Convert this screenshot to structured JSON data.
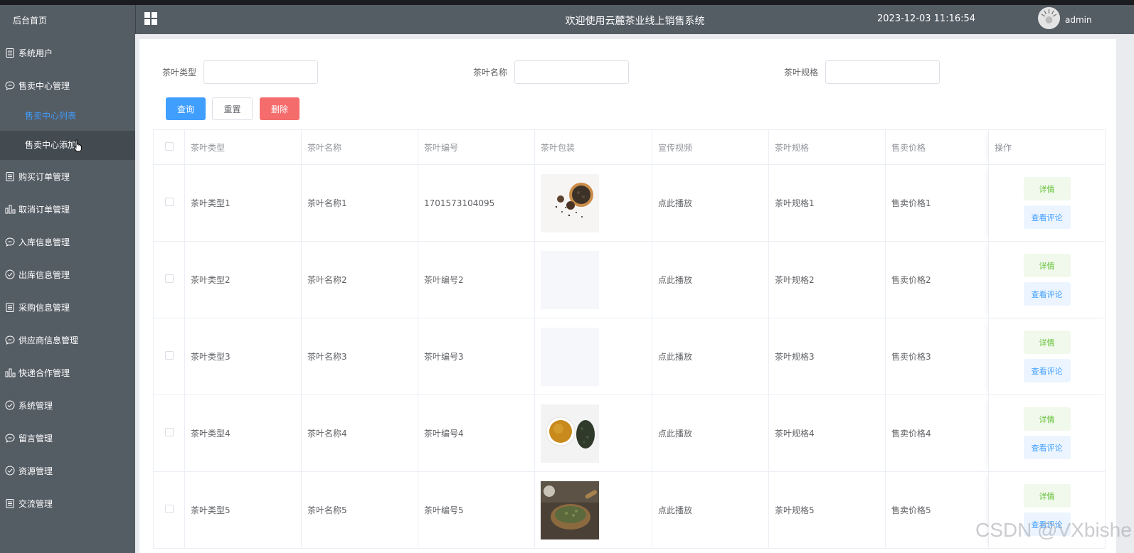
{
  "sidebar": {
    "home": "后台首页",
    "items": [
      {
        "label": "系统用户",
        "icon": "document-icon"
      },
      {
        "label": "售卖中心管理",
        "icon": "chat-icon"
      },
      {
        "label": "购买订单管理",
        "icon": "document-icon"
      },
      {
        "label": "取消订单管理",
        "icon": "bar-chart-icon"
      },
      {
        "label": "入库信息管理",
        "icon": "chat-icon"
      },
      {
        "label": "出库信息管理",
        "icon": "check-circle-icon"
      },
      {
        "label": "采购信息管理",
        "icon": "document-icon"
      },
      {
        "label": "供应商信息管理",
        "icon": "chat-icon"
      },
      {
        "label": "快递合作管理",
        "icon": "bar-chart-icon"
      },
      {
        "label": "系统管理",
        "icon": "check-circle-icon"
      },
      {
        "label": "留言管理",
        "icon": "chat-icon"
      },
      {
        "label": "资源管理",
        "icon": "check-circle-icon"
      },
      {
        "label": "交流管理",
        "icon": "document-icon"
      }
    ],
    "sub_items": [
      "售卖中心列表",
      "售卖中心添加"
    ]
  },
  "header": {
    "title": "欢迎使用云麓茶业线上销售系统",
    "datetime": "2023-12-03 11:16:54",
    "username": "admin"
  },
  "search": {
    "type_label": "茶叶类型",
    "name_label": "茶叶名称",
    "spec_label": "茶叶规格",
    "type_value": "",
    "name_value": "",
    "spec_value": ""
  },
  "buttons": {
    "query": "查询",
    "reset": "重置",
    "delete": "删除"
  },
  "table": {
    "headers": [
      "茶叶类型",
      "茶叶名称",
      "茶叶编号",
      "茶叶包装",
      "宣传视频",
      "茶叶规格",
      "售卖价格",
      "操作"
    ],
    "rows": [
      {
        "type": "茶叶类型1",
        "name": "茶叶名称1",
        "code": "1701573104095",
        "image": "tea-leaves-with-pinecones",
        "video": "点此播放",
        "spec": "茶叶规格1",
        "price": "售卖价格1"
      },
      {
        "type": "茶叶类型2",
        "name": "茶叶名称2",
        "code": "茶叶编号2",
        "image": "empty",
        "video": "点此播放",
        "spec": "茶叶规格2",
        "price": "售卖价格2"
      },
      {
        "type": "茶叶类型3",
        "name": "茶叶名称3",
        "code": "茶叶编号3",
        "image": "empty",
        "video": "点此播放",
        "spec": "茶叶规格3",
        "price": "售卖价格3"
      },
      {
        "type": "茶叶类型4",
        "name": "茶叶名称4",
        "code": "茶叶编号4",
        "image": "tea-cup-with-leaves",
        "video": "点此播放",
        "spec": "茶叶规格4",
        "price": "售卖价格4"
      },
      {
        "type": "茶叶类型5",
        "name": "茶叶名称5",
        "code": "茶叶编号5",
        "image": "tea-leaves-in-bowl",
        "video": "点此播放",
        "spec": "茶叶规格5",
        "price": "售卖价格5"
      }
    ],
    "detail_label": "详情",
    "review_label": "查看评论"
  },
  "watermark": "CSDN @VXbishe",
  "colors": {
    "sidebar_bg": "#545c64",
    "accent": "#409eff",
    "danger": "#f56c6c",
    "success": "#67c23a"
  }
}
